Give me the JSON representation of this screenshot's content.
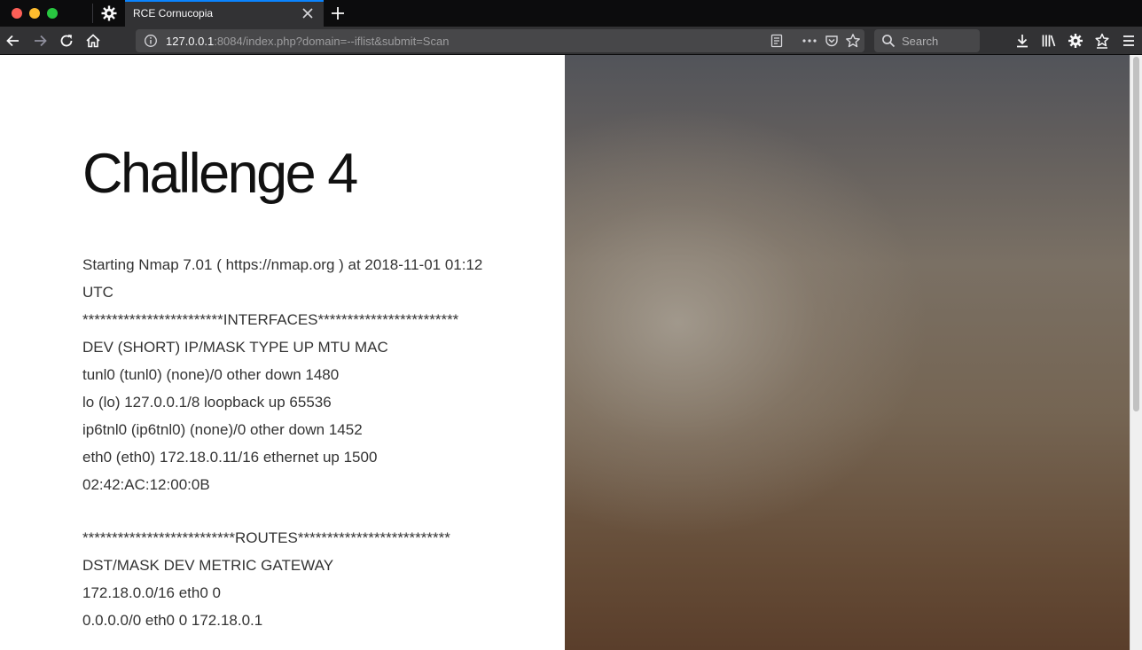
{
  "browser": {
    "tab": {
      "title": "RCE Cornucopia"
    },
    "url": {
      "host": "127.0.0.1",
      "rest": ":8084/index.php?domain=--iflist&submit=Scan"
    },
    "search": {
      "placeholder": "Search"
    }
  },
  "page": {
    "heading": "Challenge 4",
    "output_lines": [
      "Starting Nmap 7.01 ( https://nmap.org ) at 2018-11-01 01:12",
      "UTC",
      "************************INTERFACES************************",
      "DEV (SHORT) IP/MASK TYPE UP MTU MAC",
      "tunl0 (tunl0) (none)/0 other down 1480",
      "lo (lo) 127.0.0.1/8 loopback up 65536",
      "ip6tnl0 (ip6tnl0) (none)/0 other down 1452",
      "eth0 (eth0) 172.18.0.11/16 ethernet up 1500",
      "02:42:AC:12:00:0B",
      "",
      "**************************ROUTES**************************",
      "DST/MASK DEV METRIC GATEWAY",
      "172.18.0.0/16 eth0 0",
      "0.0.0.0/0 eth0 0 172.18.0.1"
    ]
  },
  "colors": {
    "tab_accent": "#0a84ff",
    "toolbar": "#323234",
    "tabstrip": "#0c0c0d"
  },
  "icons": {
    "tab_favicon": "gear-icon",
    "tab_close": "close-icon",
    "new_tab": "plus-icon",
    "back": "back-arrow-icon",
    "forward": "forward-arrow-icon",
    "reload": "reload-icon",
    "home": "home-icon",
    "site_info": "info-icon",
    "reader": "reader-view-icon",
    "page_actions": "more-icon",
    "pocket": "pocket-icon",
    "bookmark": "star-icon",
    "search": "search-icon",
    "downloads": "download-icon",
    "library": "library-icon",
    "extension": "gear-icon",
    "extension2": "bookmark-star-icon",
    "menu": "hamburger-menu-icon"
  }
}
